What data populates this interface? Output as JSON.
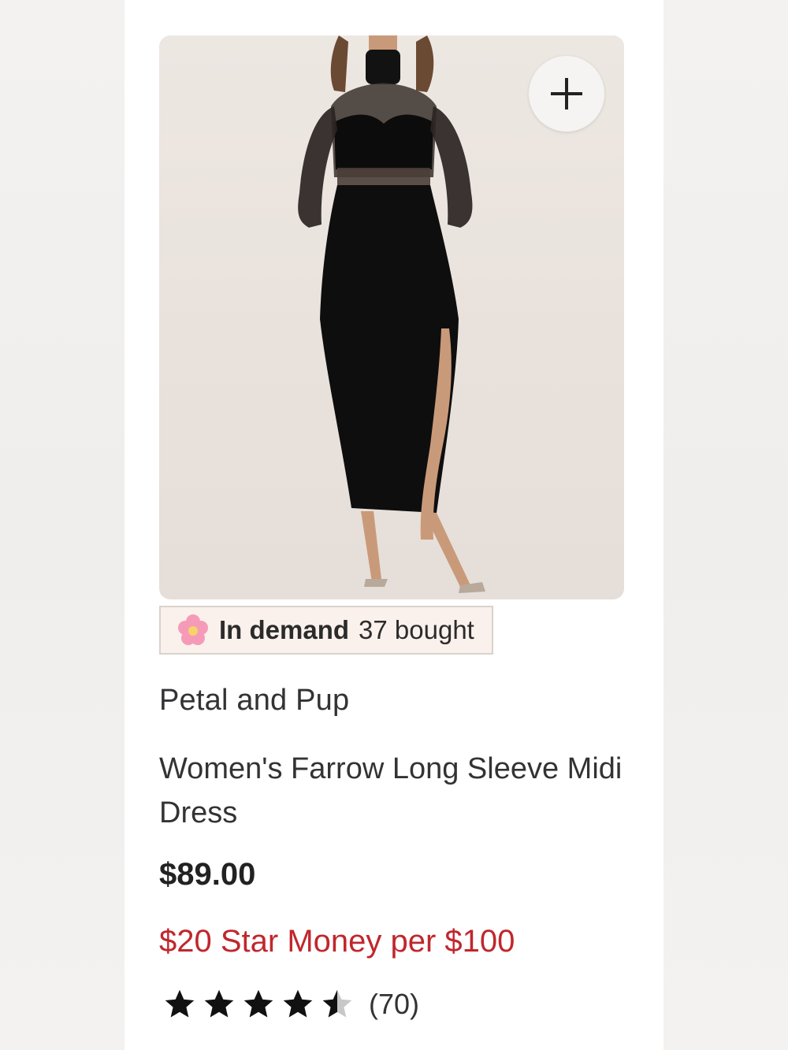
{
  "product": {
    "image_alt": "Black long sleeve midi dress with sheer mesh panels",
    "add_button_icon": "plus-icon",
    "badge": {
      "icon": "flower-icon",
      "label": "In demand",
      "count_text": "37 bought",
      "background": "#fbf1ec"
    },
    "brand": "Petal and Pup",
    "title": "Women's Farrow Long Sleeve Midi Dress",
    "price": "$89.00",
    "promo": "$20 Star Money per $100",
    "promo_color": "#c0272d",
    "rating": {
      "value": 4.5,
      "max": 5,
      "count_text": "(70)"
    }
  }
}
